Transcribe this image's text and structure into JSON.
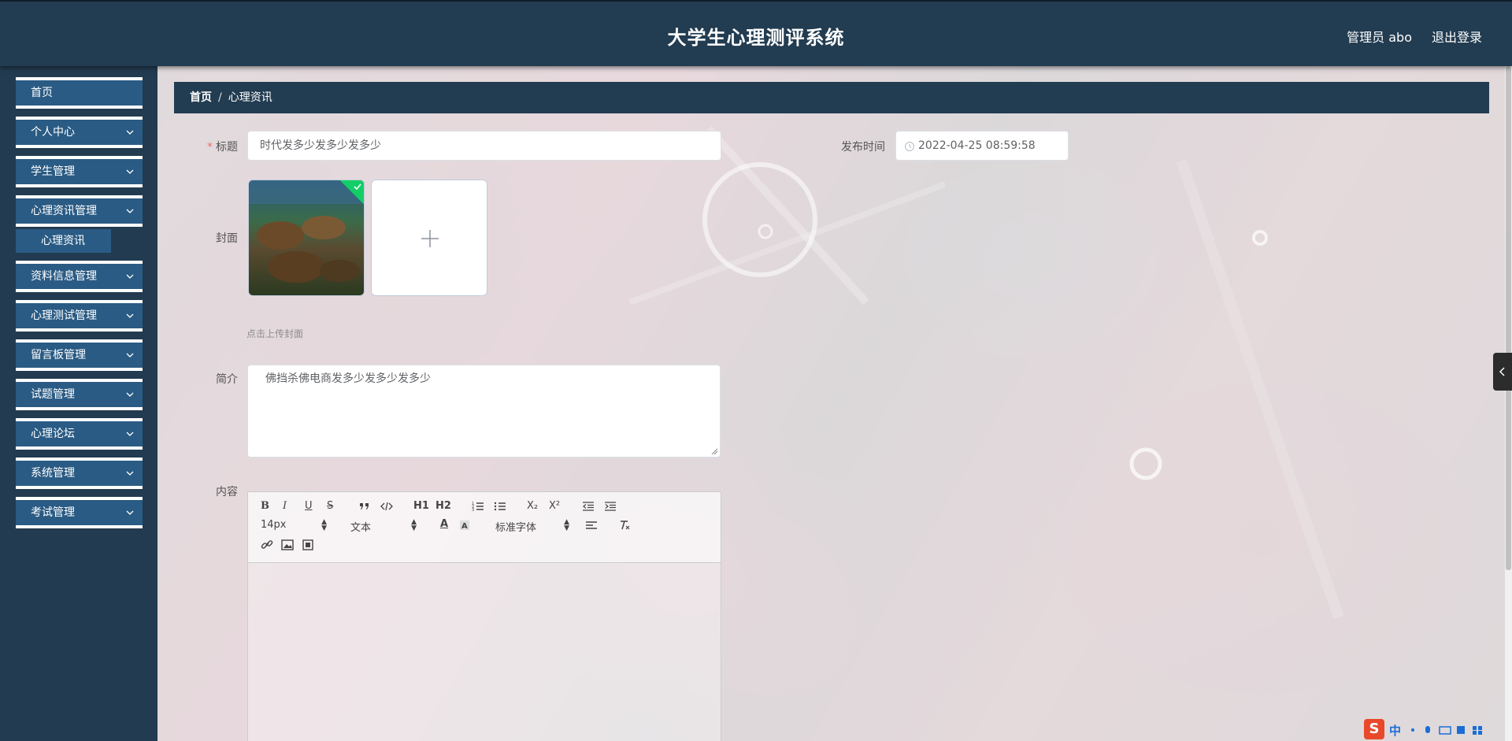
{
  "header": {
    "title": "大学生心理测评系统",
    "user_label": "管理员 abo",
    "logout_label": "退出登录"
  },
  "sidebar": {
    "items": [
      {
        "label": "首页",
        "has_arrow": false
      },
      {
        "label": "个人中心",
        "has_arrow": true
      },
      {
        "label": "学生管理",
        "has_arrow": true
      },
      {
        "label": "心理资讯管理",
        "has_arrow": true
      },
      {
        "label": "资料信息管理",
        "has_arrow": true
      },
      {
        "label": "心理测试管理",
        "has_arrow": true
      },
      {
        "label": "留言板管理",
        "has_arrow": true
      },
      {
        "label": "试题管理",
        "has_arrow": true
      },
      {
        "label": "心理论坛",
        "has_arrow": true
      },
      {
        "label": "系统管理",
        "has_arrow": true
      },
      {
        "label": "考试管理",
        "has_arrow": true
      }
    ],
    "submenu": {
      "label": "心理资讯",
      "parent": "心理资讯管理"
    }
  },
  "breadcrumb": {
    "home": "首页",
    "separator": "/",
    "current": "心理资讯"
  },
  "form": {
    "title_label": "标题",
    "title_value": "时代发多少发多少发多少",
    "publish_time_label": "发布时间",
    "publish_time_value": "2022-04-25 08:59:58",
    "cover_label": "封面",
    "cover_hint": "点击上传封面",
    "intro_label": "简介",
    "intro_value": "佛挡杀佛电商发多少发多少发多少",
    "content_label": "内容"
  },
  "editor": {
    "toolbar": {
      "bold": "B",
      "italic": "I",
      "underline": "U",
      "strike": "S",
      "h1": "H1",
      "h2": "H2",
      "sub": "X₂",
      "sup": "X²",
      "size_value": "14px",
      "header_value": "文本",
      "font_value": "标准字体",
      "color": "A"
    }
  },
  "ime": {
    "logo": "S",
    "lang": "中"
  },
  "colors": {
    "header_bg": "#223c51",
    "menu_item_bg": "#2a5b84",
    "success_badge": "#13ce66",
    "required_mark": "#f56c6c"
  }
}
